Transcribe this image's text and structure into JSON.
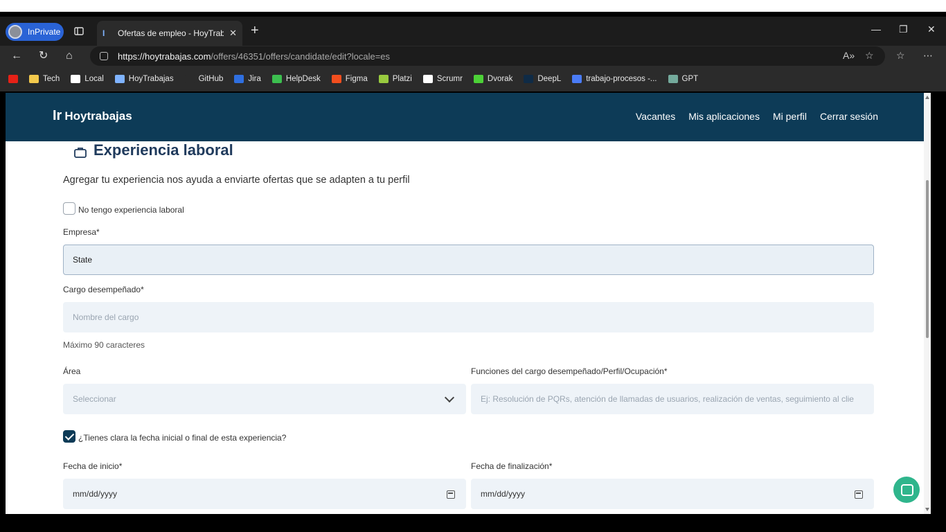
{
  "browser": {
    "profile_label": "InPrivate",
    "tab_title": "Ofertas de empleo - HoyTrabajas",
    "url_host": "https://hoytrabajas.com",
    "url_path": "/offers/46351/offers/candidate/edit?locale=es",
    "bookmarks": [
      {
        "label": "",
        "color": "#e62117"
      },
      {
        "label": "Tech",
        "color": "#f2c94c"
      },
      {
        "label": "Local",
        "color": "#ffffff"
      },
      {
        "label": "HoyTrabajas",
        "color": "#7fb3ff"
      },
      {
        "label": "GitHub",
        "color": "#2b2b2b"
      },
      {
        "label": "Jira",
        "color": "#2f6fe0"
      },
      {
        "label": "HelpDesk",
        "color": "#3cbf4f"
      },
      {
        "label": "Figma",
        "color": "#f24e1e"
      },
      {
        "label": "Platzi",
        "color": "#98ca3f"
      },
      {
        "label": "Scrumr",
        "color": "#ffffff"
      },
      {
        "label": "Dvorak",
        "color": "#4cd137"
      },
      {
        "label": "DeepL",
        "color": "#0f2b46"
      },
      {
        "label": "trabajo-procesos -...",
        "color": "#4a7cf7"
      },
      {
        "label": "GPT",
        "color": "#74aa9c"
      }
    ]
  },
  "site": {
    "logo_text": "Hoytrabajas",
    "nav": [
      "Vacantes",
      "Mis aplicaciones",
      "Mi perfil",
      "Cerrar sesión"
    ]
  },
  "form": {
    "section_title": "Experiencia laboral",
    "subtitle": "Agregar tu experiencia nos ayuda a enviarte ofertas que se adapten a tu perfil",
    "no_experience_label": "No tengo experiencia laboral",
    "empresa_label": "Empresa*",
    "empresa_value": "State",
    "cargo_label": "Cargo desempeñado*",
    "cargo_placeholder": "Nombre del cargo",
    "cargo_hint": "Máximo 90 caracteres",
    "area_label": "Área",
    "area_value": "Seleccionar",
    "funciones_label": "Funciones del cargo desempeñado/Perfil/Ocupación*",
    "funciones_placeholder": "Ej: Resolución de PQRs, atención de llamadas de usuarios, realización de ventas, seguimiento al clie",
    "date_known_label": "¿Tienes clara la fecha inicial o final de esta experiencia?",
    "fecha_inicio_label": "Fecha de inicio*",
    "fecha_inicio_value": "mm/dd/yyyy",
    "fecha_fin_label": "Fecha de finalización*",
    "fecha_fin_value": "mm/dd/yyyy"
  }
}
